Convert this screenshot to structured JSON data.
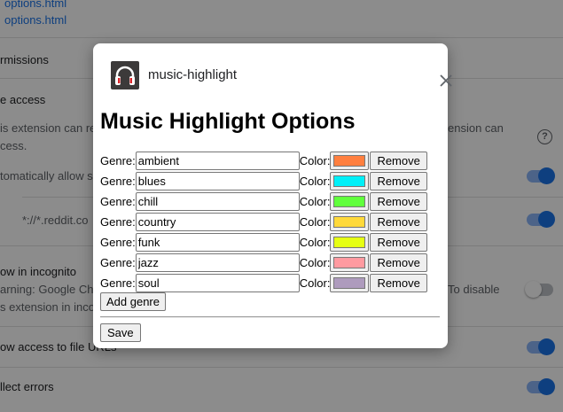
{
  "background": {
    "links": [
      "options.html",
      "options.html"
    ],
    "permissions_label": "rmissions",
    "site_access_label": "e access",
    "desc_left_line1": "is extension can re",
    "desc_left_line2": "cess.",
    "desc_right": "ension can",
    "auto_allow_label": "tomatically allow s",
    "site_pattern": "*://*.reddit.co",
    "incognito_label": "ow in incognito",
    "incognito_warning_left": "arning: Google Chr",
    "incognito_warning_right": "To disable",
    "incognito_line2": "s extension in inco",
    "file_urls_label": "ow access to file URLs",
    "collect_errors_label": "llect errors"
  },
  "dialog": {
    "app_name": "music-highlight",
    "title": "Music Highlight Options",
    "genre_label": "Genre:",
    "color_label": "Color:",
    "remove_label": "Remove",
    "add_label": "Add genre",
    "save_label": "Save",
    "genres": [
      {
        "name": "ambient",
        "color": "#ff7f3f"
      },
      {
        "name": "blues",
        "color": "#00f0f8"
      },
      {
        "name": "chill",
        "color": "#60ff3c"
      },
      {
        "name": "country",
        "color": "#ffd93a"
      },
      {
        "name": "funk",
        "color": "#e6ff13"
      },
      {
        "name": "jazz",
        "color": "#ff9aa0"
      },
      {
        "name": "soul",
        "color": "#ae9bbd"
      }
    ]
  }
}
